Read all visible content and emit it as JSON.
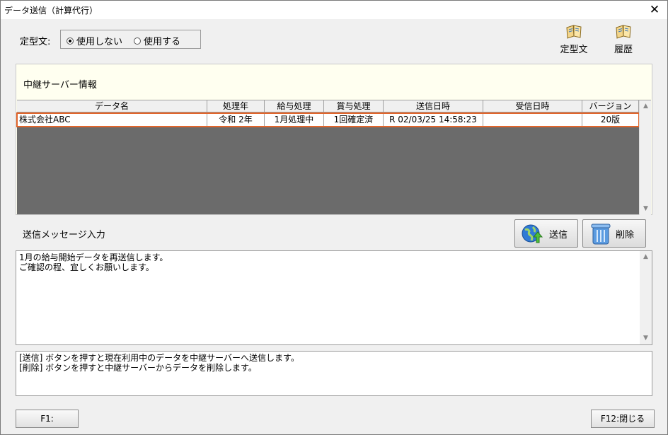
{
  "window": {
    "title": "データ送信（計算代行）",
    "close_glyph": "✕"
  },
  "teikei": {
    "label": "定型文:",
    "options": [
      {
        "label": "使用しない",
        "selected": true
      },
      {
        "label": "使用する",
        "selected": false
      }
    ]
  },
  "toolbar": {
    "teikei_label": "定型文",
    "history_label": "履歴"
  },
  "relay": {
    "title": "中継サーバー情報",
    "columns": [
      "データ名",
      "処理年",
      "給与処理",
      "賞与処理",
      "送信日時",
      "受信日時",
      "バージョン"
    ],
    "rows": [
      [
        "株式会社ABC",
        "令和  2年",
        "1月処理中",
        "1回確定済",
        "R 02/03/25 14:58:23",
        "",
        "20版"
      ]
    ]
  },
  "message": {
    "label": "送信メッセージ入力",
    "send_label": "送信",
    "delete_label": "削除",
    "text_lines": [
      "1月の給与開始データを再送信します。",
      "ご確認の程、宜しくお願いします。"
    ]
  },
  "help": {
    "lines": [
      "[送信] ボタンを押すと現在利用中のデータを中継サーバーへ送信します。",
      "[削除] ボタンを押すと中継サーバーからデータを削除します。"
    ]
  },
  "footer": {
    "f1_label": "F1:",
    "f12_label": "F12:閉じる"
  },
  "colors": {
    "selection_border": "#e2652b",
    "grid_background": "#6b6b6b",
    "panel_background": "#fffff0"
  },
  "icons": {
    "teikei": "book-icon",
    "history": "book-icon",
    "send": "globe-upload-icon",
    "delete": "trash-icon"
  }
}
